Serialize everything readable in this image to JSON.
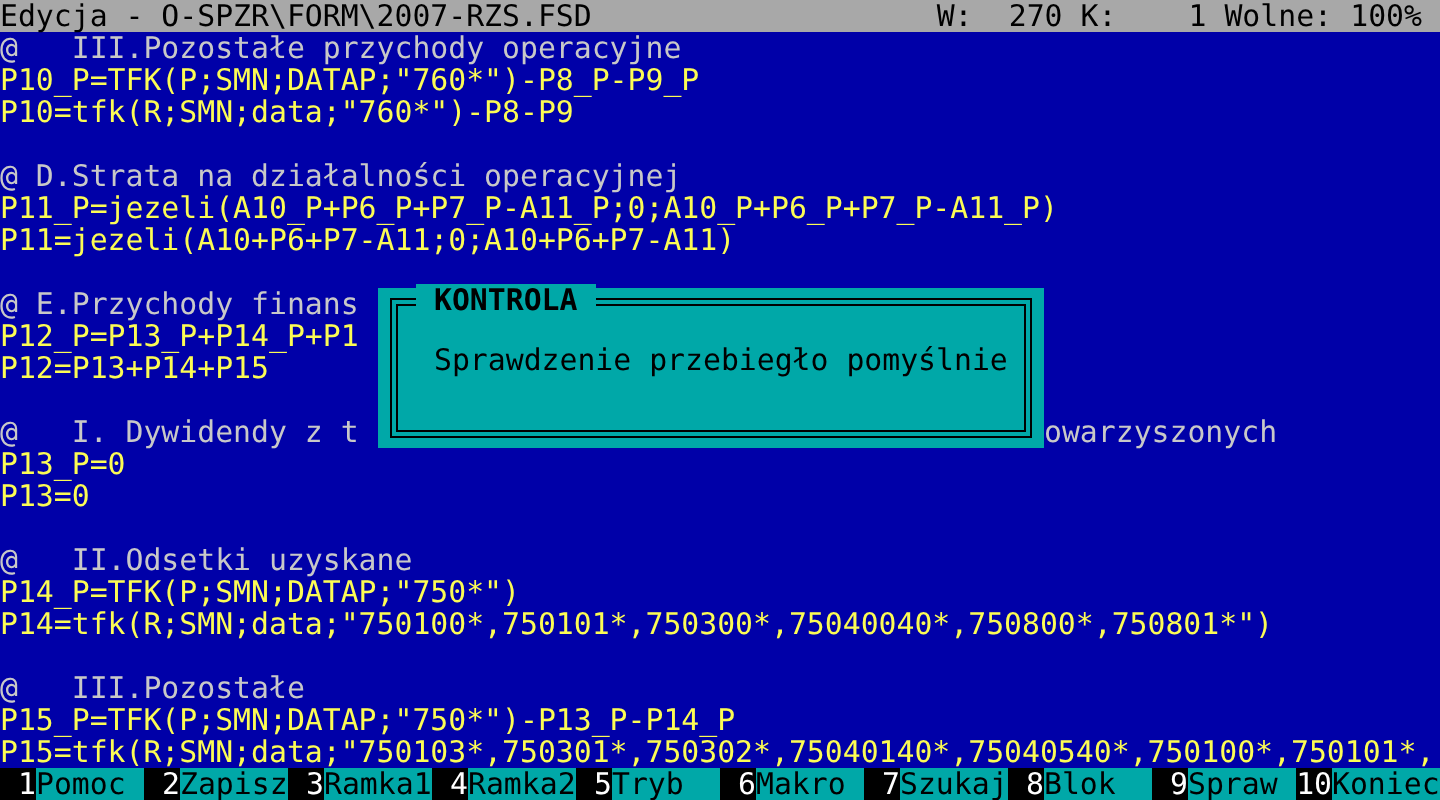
{
  "status_bar": {
    "title": "Edycja - O-SPZR\\FORM\\2007-RZS.FSD",
    "fields": [
      {
        "label": "W:",
        "value": "270"
      },
      {
        "label": "K:",
        "value": "1"
      },
      {
        "label": "Wolne:",
        "value": "100%"
      }
    ]
  },
  "editor": {
    "lines": [
      {
        "kind": "comment",
        "text": "@   III.Pozostałe przychody operacyjne"
      },
      {
        "kind": "code",
        "text": "P10_P=TFK(P;SMN;DATAP;\"760*\")-P8_P-P9_P"
      },
      {
        "kind": "code",
        "text": "P10=tfk(R;SMN;data;\"760*\")-P8-P9"
      },
      {
        "kind": "blank"
      },
      {
        "kind": "comment",
        "text": "@ D.Strata na działalności operacyjnej"
      },
      {
        "kind": "code",
        "text": "P11_P=jezeli(A10_P+P6_P+P7_P-A11_P;0;A10_P+P6_P+P7_P-A11_P)"
      },
      {
        "kind": "code",
        "text": "P11=jezeli(A10+P6+P7-A11;0;A10+P6+P7-A11)"
      },
      {
        "kind": "blank"
      },
      {
        "kind": "comment",
        "text": "@ E.Przychody finans"
      },
      {
        "kind": "code",
        "text": "P12_P=P13_P+P14_P+P1"
      },
      {
        "kind": "code",
        "text": "P12=P13+P14+P15"
      },
      {
        "kind": "blank"
      },
      {
        "kind": "comment",
        "text": "@   I. Dywidendy z t",
        "tail": "owarzyszonych"
      },
      {
        "kind": "code",
        "text": "P13_P=0"
      },
      {
        "kind": "code",
        "text": "P13=0"
      },
      {
        "kind": "blank"
      },
      {
        "kind": "comment",
        "text": "@   II.Odsetki uzyskane"
      },
      {
        "kind": "code",
        "text": "P14_P=TFK(P;SMN;DATAP;\"750*\")"
      },
      {
        "kind": "code",
        "text": "P14=tfk(R;SMN;data;\"750100*,750101*,750300*,75040040*,750800*,750801*\")"
      },
      {
        "kind": "blank"
      },
      {
        "kind": "comment",
        "text": "@   III.Pozostałe"
      },
      {
        "kind": "code",
        "text": "P15_P=TFK(P;SMN;DATAP;\"750*\")-P13_P-P14_P"
      },
      {
        "kind": "code",
        "text": "P15=tfk(R;SMN;data;\"750103*,750301*,750302*,75040140*,75040540*,750100*,750101*,"
      }
    ]
  },
  "dialog": {
    "title": "KONTROLA",
    "message": "Sprawdzenie przebiegło pomyślnie"
  },
  "function_keys": [
    {
      "number": "1",
      "label": "Pomoc"
    },
    {
      "number": "2",
      "label": "Zapisz"
    },
    {
      "number": "3",
      "label": "Ramka1"
    },
    {
      "number": "4",
      "label": "Ramka2"
    },
    {
      "number": "5",
      "label": "Tryb"
    },
    {
      "number": "6",
      "label": "Makro"
    },
    {
      "number": "7",
      "label": "Szukaj"
    },
    {
      "number": "8",
      "label": "Blok"
    },
    {
      "number": "9",
      "label": "Spraw"
    },
    {
      "number": "10",
      "label": "Koniec"
    }
  ]
}
